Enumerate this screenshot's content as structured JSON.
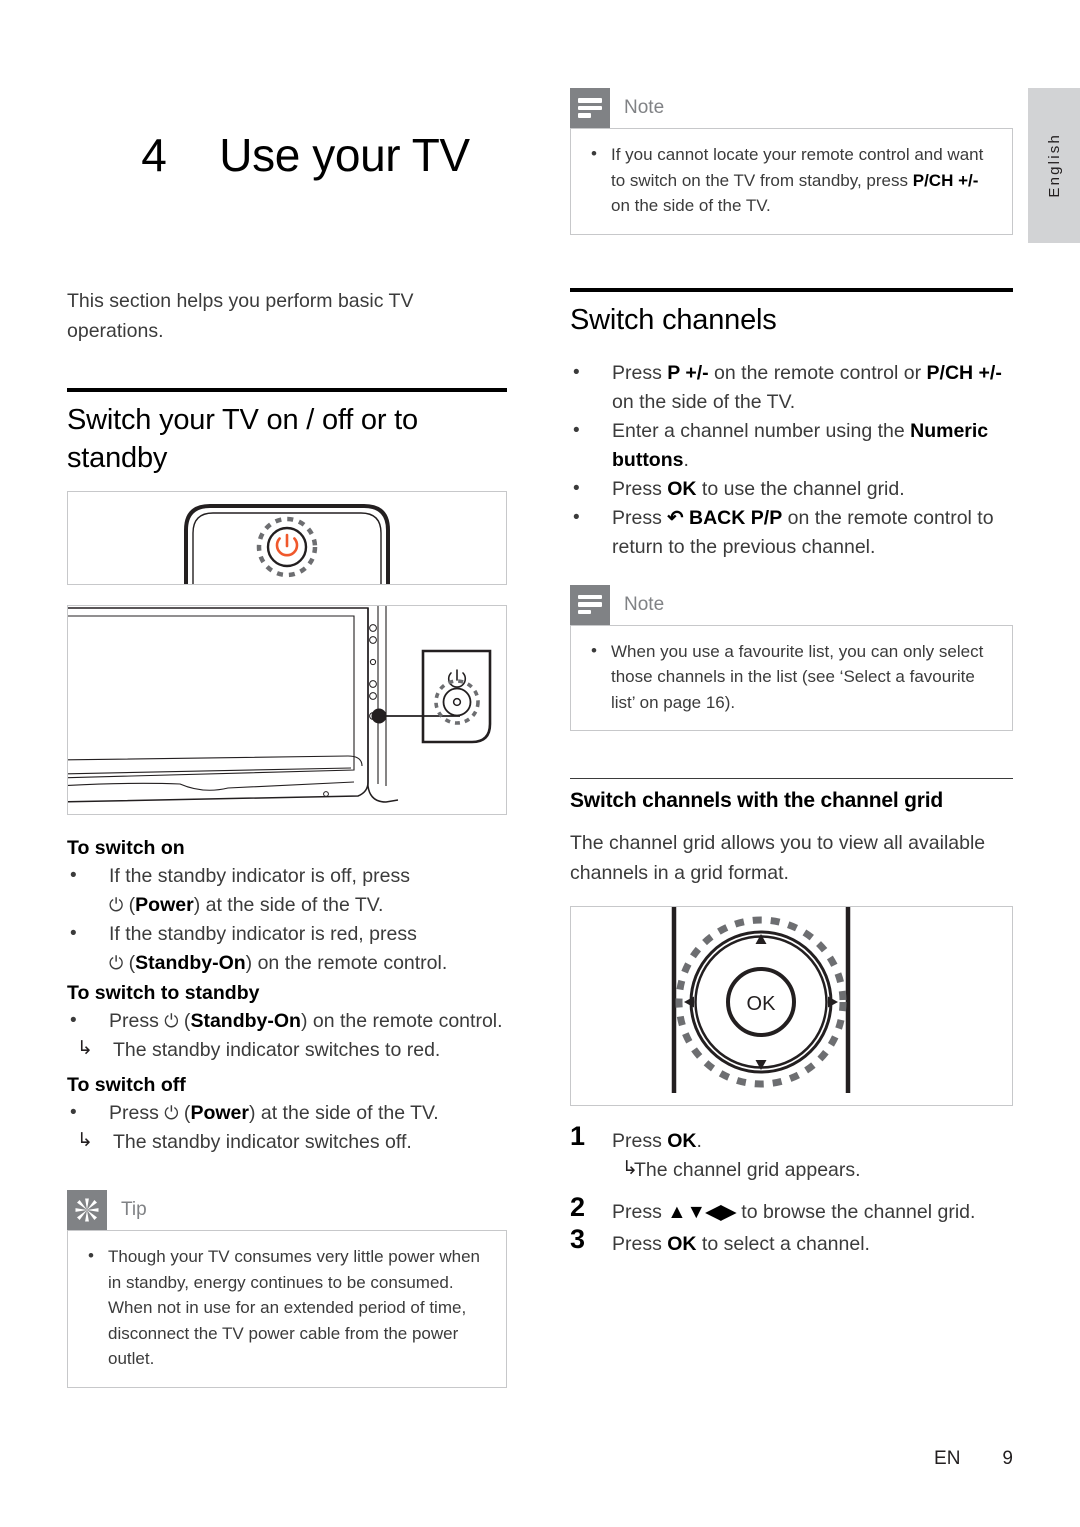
{
  "language_tab": {
    "label": "English"
  },
  "chapter": {
    "number": "4",
    "title": "Use your TV"
  },
  "intro": "This section helps you perform basic TV operations.",
  "left_column": {
    "heading": "Switch your TV on / off or to standby",
    "figure_power_button": {
      "caption": "tv-top-power-button-illustration"
    },
    "figure_tv_side": {
      "caption": "tv-side-panel-power-button-illustration"
    },
    "switch_on": {
      "heading": "To switch on",
      "items": [
        {
          "prefix": "If the standby indicator is off, press ",
          "symbol": "⏻",
          "bold": "Power",
          "suffix": ") at the side of the TV.",
          "open_paren": " ("
        },
        {
          "prefix": "If the standby indicator is red, press ",
          "symbol": "⏻",
          "bold": "Standby-On",
          "suffix": ") on the remote control.",
          "open_paren": " ("
        }
      ]
    },
    "switch_standby": {
      "heading": "To switch to standby",
      "item": {
        "prefix": "Press ",
        "symbol": "⏻",
        "open_paren": " (",
        "bold": "Standby-On",
        "suffix": ") on the remote control."
      },
      "result": "The standby indicator switches to red."
    },
    "switch_off": {
      "heading": "To switch off",
      "item": {
        "prefix": "Press ",
        "symbol": "⏻",
        "open_paren": " (",
        "bold": "Power",
        "suffix": ") at the side of the TV."
      },
      "result": "The standby indicator switches off."
    },
    "tip": {
      "title": "Tip",
      "icon": "asterisk-burst-icon",
      "items": [
        "Though your TV consumes very little power when in standby, energy continues to be consumed. When not in use for an extended period of time, disconnect the TV power cable from the power outlet."
      ]
    }
  },
  "right_column": {
    "note_top": {
      "title": "Note",
      "icon": "lines-note-icon",
      "item": {
        "prefix": "If you cannot locate your remote control and want to switch on the TV from standby, press ",
        "bold": "P/CH +/-",
        "suffix": " on the side of the TV."
      }
    },
    "heading": "Switch channels",
    "bullets": [
      {
        "p1": "Press ",
        "b1": "P +/-",
        "p2": " on the remote control or ",
        "b2": "P/CH +/-",
        "p3": " on the side of the TV."
      },
      {
        "p1": "Enter a channel number using the ",
        "b1": "Numeric buttons",
        "p2": ".",
        "b2": "",
        "p3": ""
      },
      {
        "p1": "Press ",
        "b1": "OK",
        "p2": " to use the channel grid.",
        "b2": "",
        "p3": ""
      },
      {
        "p1": "Press ",
        "b1": "↶ BACK P/P",
        "p2": " on the remote control to return to the previous channel.",
        "b2": "",
        "p3": ""
      }
    ],
    "note_bottom": {
      "title": "Note",
      "icon": "lines-note-icon",
      "item": "When you use a favourite list, you can only select those channels in the list (see ‘Select a favourite list’ on page 16)."
    },
    "subheading": "Switch channels with the channel grid",
    "sub_para": "The channel grid allows you to view all available channels in a grid format.",
    "figure_okpad": {
      "caption": "remote-control-ok-navigation-pad-illustration",
      "ok_label": "OK"
    },
    "steps": [
      {
        "num": "1",
        "p1": "Press ",
        "b1": "OK",
        "p2": ".",
        "result": "The channel grid appears."
      },
      {
        "num": "2",
        "p1": "Press ",
        "b1": "▲▼◀▶",
        "p2": " to browse the channel grid.",
        "result": ""
      },
      {
        "num": "3",
        "p1": "Press ",
        "b1": "OK",
        "p2": " to select a channel.",
        "result": ""
      }
    ]
  },
  "footer": {
    "lang_code": "EN",
    "page_number": "9"
  },
  "colors": {
    "callout_icon_bg": "#808285",
    "callout_title": "#808285",
    "callout_border": "#c7c8ca",
    "lang_tab_bg": "#d2d3d5",
    "body_text": "#3b3b3b",
    "power_led": "#f0582c"
  }
}
